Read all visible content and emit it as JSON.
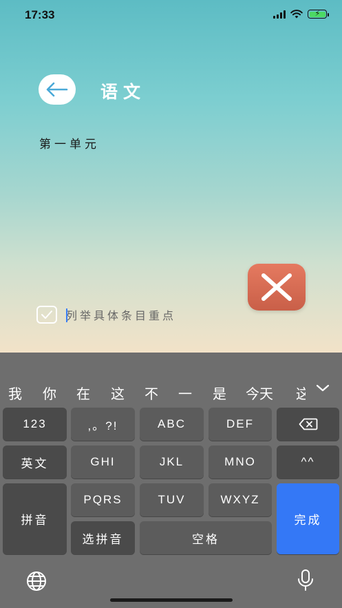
{
  "status_bar": {
    "time": "17:33"
  },
  "header": {
    "title": "语文"
  },
  "section": {
    "label": "第一单元"
  },
  "item": {
    "placeholder": "列举具体条目重点",
    "checked": true
  },
  "keyboard": {
    "candidates": [
      "我",
      "你",
      "在",
      "这",
      "不",
      "一",
      "是",
      "今天",
      "这"
    ],
    "keys": {
      "num": "123",
      "punct": ",。?!",
      "abc": "ABC",
      "def": "DEF",
      "english": "英文",
      "ghi": "GHI",
      "jkl": "JKL",
      "mno": "MNO",
      "emoji": "^^",
      "pinyin": "拼音",
      "pqrs": "PQRS",
      "tuv": "TUV",
      "wxyz": "WXYZ",
      "done": "完成",
      "select_pinyin": "选拼音",
      "space": "空格"
    }
  },
  "colors": {
    "delete_button": "#d86a52",
    "done_key": "#3478f6",
    "battery": "#4cd964"
  },
  "icons": [
    "back-arrow-icon",
    "close-x-icon",
    "checkmark-icon",
    "backspace-icon",
    "globe-icon",
    "microphone-icon",
    "chevron-down-icon",
    "wifi-icon",
    "signal-icon",
    "battery-icon"
  ]
}
